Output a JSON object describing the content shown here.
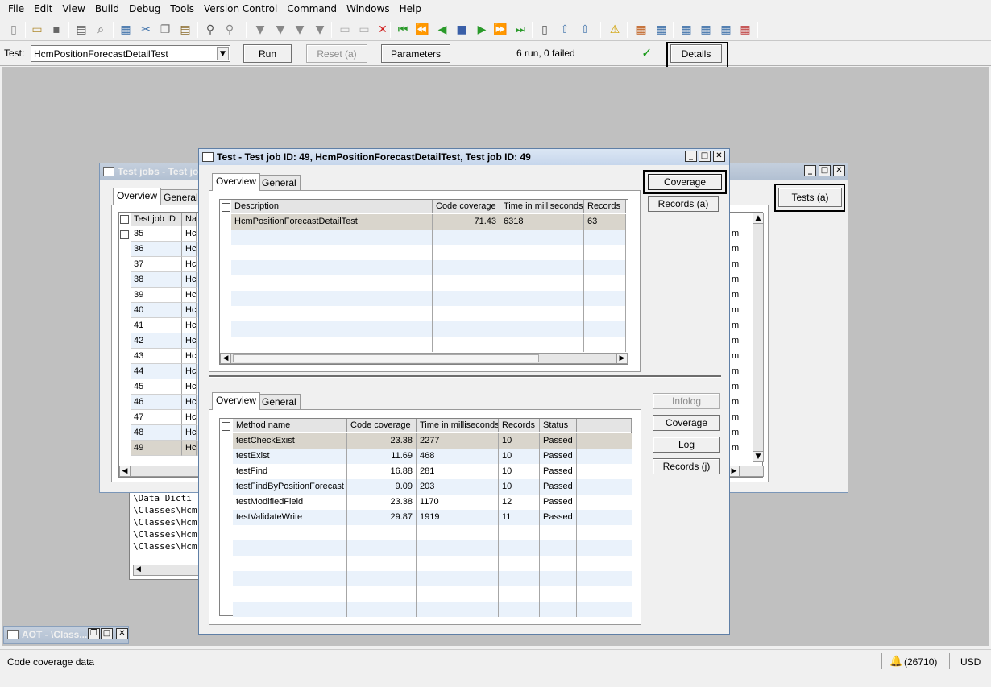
{
  "menu": [
    "File",
    "Edit",
    "View",
    "Build",
    "Debug",
    "Tools",
    "Version Control",
    "Command",
    "Windows",
    "Help"
  ],
  "testbar": {
    "label": "Test:",
    "test_value": "HcmPositionForecastDetailTest",
    "run": "Run",
    "reset": "Reset (a)",
    "parameters": "Parameters",
    "result": "6 run, 0 failed",
    "details": "Details",
    "check": "✓"
  },
  "testjobs": {
    "title": "Test jobs - Test jo",
    "tab_overview": "Overview",
    "tab_general": "General",
    "col_id": "Test job ID",
    "col_name": "Na",
    "ids": [
      "35",
      "36",
      "37",
      "38",
      "39",
      "40",
      "41",
      "42",
      "43",
      "44",
      "45",
      "46",
      "47",
      "48",
      "49"
    ],
    "name_prefix": "Hc",
    "right_col": "m",
    "tests_button": "Tests (a)"
  },
  "infolog": {
    "lines": [
      "\\Data Dicti",
      "\\Classes\\Hcm",
      "\\Classes\\Hcm",
      "\\Classes\\Hcm",
      "\\Classes\\Hcm"
    ]
  },
  "aot": {
    "title": "AOT - \\Class..."
  },
  "testwin": {
    "title": "Test - Test job ID: 49, HcmPositionForecastDetailTest, Test job ID: 49",
    "tab_overview": "Overview",
    "tab_general": "General",
    "upper_headers": [
      "Description",
      "Code coverage",
      "Time in milliseconds",
      "Records"
    ],
    "upper_row": {
      "description": "HcmPositionForecastDetailTest",
      "coverage": "71.43",
      "time": "6318",
      "records": "63"
    },
    "coverage_btn": "Coverage",
    "records_btn": "Records (a)",
    "lower_headers": [
      "Method name",
      "Code coverage",
      "Time in milliseconds",
      "Records",
      "Status"
    ],
    "methods": [
      {
        "name": "testCheckExist",
        "coverage": "23.38",
        "time": "2277",
        "records": "10",
        "status": "Passed"
      },
      {
        "name": "testExist",
        "coverage": "11.69",
        "time": "468",
        "records": "10",
        "status": "Passed"
      },
      {
        "name": "testFind",
        "coverage": "16.88",
        "time": "281",
        "records": "10",
        "status": "Passed"
      },
      {
        "name": "testFindByPositionForecast",
        "coverage": "9.09",
        "time": "203",
        "records": "10",
        "status": "Passed"
      },
      {
        "name": "testModifiedField",
        "coverage": "23.38",
        "time": "1170",
        "records": "12",
        "status": "Passed"
      },
      {
        "name": "testValidateWrite",
        "coverage": "29.87",
        "time": "1919",
        "records": "11",
        "status": "Passed"
      }
    ],
    "infolog_btn": "Infolog",
    "coverage2_btn": "Coverage",
    "log_btn": "Log",
    "records_j_btn": "Records (j)"
  },
  "status": {
    "text": "Code coverage data",
    "alerts": "(26710)",
    "currency": "USD"
  },
  "colors": {
    "selected_row": "#d9d5cc",
    "title_active": "#c6d6ec",
    "highlight_border": "#000000"
  }
}
